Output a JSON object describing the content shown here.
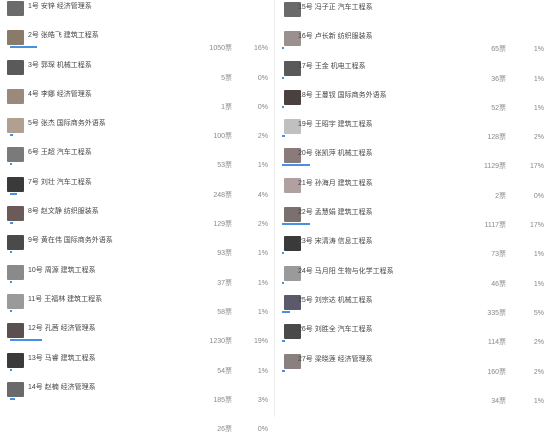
{
  "left": [
    {
      "name": "1号 安锌 经济管理系",
      "votes": "",
      "pct": "",
      "thumb": "#6b6b6b",
      "bar": 0
    },
    {
      "name": "2号 张皓飞 建筑工程系",
      "votes": "1050票",
      "pct": "16%",
      "thumb": "#8a7a6a",
      "bar": 0.16
    },
    {
      "name": "3号 郭琛 机械工程系",
      "votes": "5票",
      "pct": "0%",
      "thumb": "#5a5a5a",
      "bar": 0
    },
    {
      "name": "4号 李娜 经济管理系",
      "votes": "1票",
      "pct": "0%",
      "thumb": "#9a8a7a",
      "bar": 0
    },
    {
      "name": "5号 张杰 国际商务外语系",
      "votes": "100票",
      "pct": "2%",
      "thumb": "#b0a090",
      "bar": 0.02
    },
    {
      "name": "6号 王超 汽车工程系",
      "votes": "53票",
      "pct": "1%",
      "thumb": "#7a7a7a",
      "bar": 0.01
    },
    {
      "name": "7号 刘壮 汽车工程系",
      "votes": "248票",
      "pct": "4%",
      "thumb": "#3a3a3a",
      "bar": 0.04
    },
    {
      "name": "8号 赵文静 纺织服装系",
      "votes": "129票",
      "pct": "2%",
      "thumb": "#6a5a5a",
      "bar": 0.02
    },
    {
      "name": "9号 黄在伟 国际商务外语系",
      "votes": "93票",
      "pct": "1%",
      "thumb": "#4a4a4a",
      "bar": 0.01
    },
    {
      "name": "10号 周源 建筑工程系",
      "votes": "37票",
      "pct": "1%",
      "thumb": "#8a8a8a",
      "bar": 0.01
    },
    {
      "name": "11号 王福林 建筑工程系",
      "votes": "58票",
      "pct": "1%",
      "thumb": "#9a9a9a",
      "bar": 0.01
    },
    {
      "name": "12号 孔茜 经济管理系",
      "votes": "1230票",
      "pct": "19%",
      "thumb": "#5a5050",
      "bar": 0.19
    },
    {
      "name": "13号 马睿 建筑工程系",
      "votes": "54票",
      "pct": "1%",
      "thumb": "#3a3a3a",
      "bar": 0.01
    },
    {
      "name": "14号 赵楠 经济管理系",
      "votes": "185票",
      "pct": "3%",
      "thumb": "#6a6a6a",
      "bar": 0.03
    },
    {
      "name": "",
      "votes": "26票",
      "pct": "0%",
      "thumb": "",
      "bar": 0
    }
  ],
  "right": [
    {
      "name": "15号 冯子正 汽车工程系",
      "votes": "",
      "pct": "",
      "thumb": "#6a6a6a",
      "bar": 0
    },
    {
      "name": "16号 卢长新 纺织服装系",
      "votes": "65票",
      "pct": "1%",
      "thumb": "#9a9090",
      "bar": 0.01
    },
    {
      "name": "17号 王金 机电工程系",
      "votes": "36票",
      "pct": "1%",
      "thumb": "#5a5a5a",
      "bar": 0.01
    },
    {
      "name": "18号 王蔓钗 国际商务外语系",
      "votes": "52票",
      "pct": "1%",
      "thumb": "#4a4040",
      "bar": 0.01
    },
    {
      "name": "19号 王昭宇 建筑工程系",
      "votes": "128票",
      "pct": "2%",
      "thumb": "#c0c0c0",
      "bar": 0.02
    },
    {
      "name": "20号 张凯萍 机械工程系",
      "votes": "1129票",
      "pct": "17%",
      "thumb": "#8a7a7a",
      "bar": 0.17
    },
    {
      "name": "21号 孙海月 建筑工程系",
      "votes": "2票",
      "pct": "0%",
      "thumb": "#b0a0a0",
      "bar": 0
    },
    {
      "name": "22号 孟慧娟 建筑工程系",
      "votes": "1117票",
      "pct": "17%",
      "thumb": "#7a7070",
      "bar": 0.17
    },
    {
      "name": "23号 宋清涛 信息工程系",
      "votes": "73票",
      "pct": "1%",
      "thumb": "#3a3a3a",
      "bar": 0.01
    },
    {
      "name": "24号 马月阳 生物与化学工程系",
      "votes": "46票",
      "pct": "1%",
      "thumb": "#9a9a9a",
      "bar": 0.01
    },
    {
      "name": "25号 刘宗达 机械工程系",
      "votes": "335票",
      "pct": "5%",
      "thumb": "#5a5a6a",
      "bar": 0.05
    },
    {
      "name": "26号 刘胜全 汽车工程系",
      "votes": "114票",
      "pct": "2%",
      "thumb": "#4a4a4a",
      "bar": 0.02
    },
    {
      "name": "27号 梁晓莲 经济管理系",
      "votes": "160票",
      "pct": "2%",
      "thumb": "#8a8080",
      "bar": 0.02
    },
    {
      "name": "",
      "votes": "34票",
      "pct": "1%",
      "thumb": "",
      "bar": 0
    }
  ]
}
